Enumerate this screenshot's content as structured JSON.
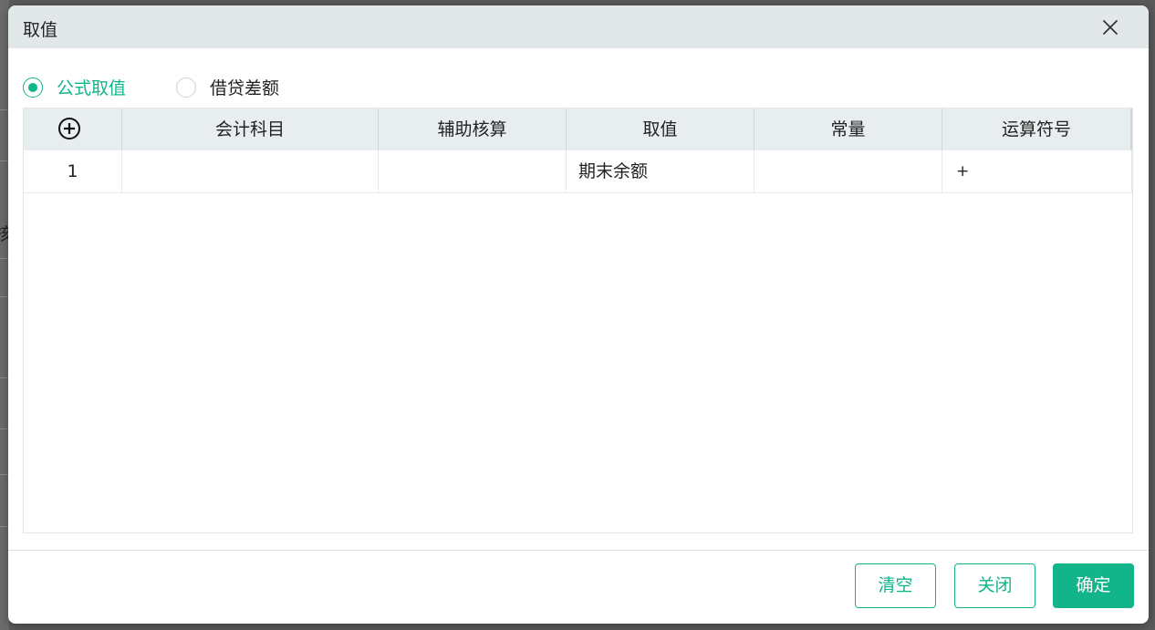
{
  "dialog": {
    "title": "取值"
  },
  "background": {
    "partial_char": "核"
  },
  "mode_options": [
    {
      "label": "公式取值",
      "selected": true
    },
    {
      "label": "借贷差额",
      "selected": false
    }
  ],
  "table": {
    "columns": [
      "会计科目",
      "辅助核算",
      "取值",
      "常量",
      "运算符号"
    ],
    "rows": [
      {
        "index": "1",
        "account": "",
        "auxiliary": "",
        "value_type": "期末余额",
        "constant": "",
        "operator": "+"
      }
    ]
  },
  "footer": {
    "clear_label": "清空",
    "close_label": "关闭",
    "confirm_label": "确定"
  },
  "colors": {
    "accent": "#12b48a",
    "header_bg": "#e2e8ea",
    "table_header_bg": "#e8edef"
  },
  "icons": {
    "close": "close-icon",
    "add_row": "plus-circle-icon"
  }
}
